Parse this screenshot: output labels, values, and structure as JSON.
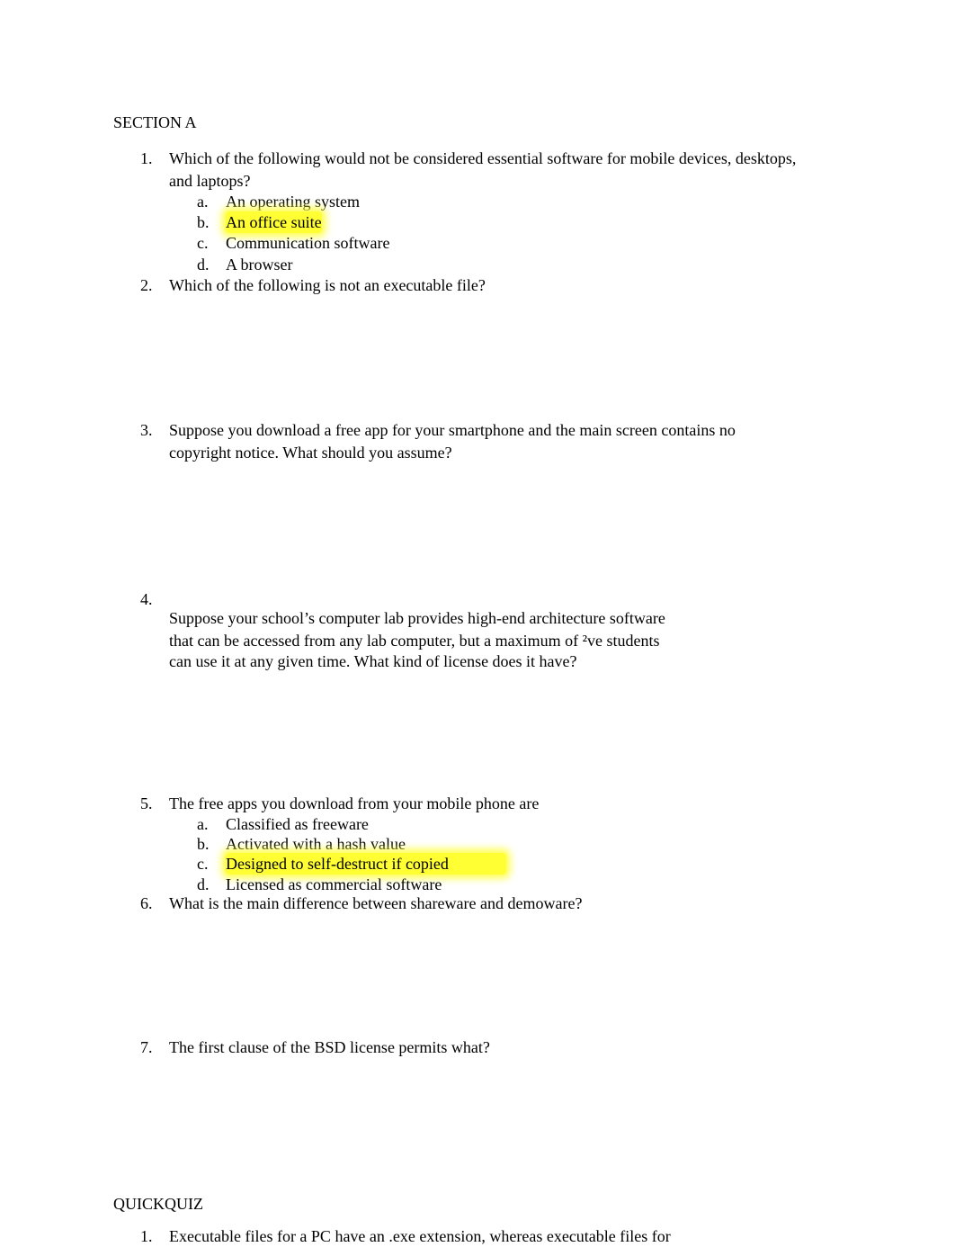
{
  "sections": {
    "section_a_title": "SECTION A",
    "quickquiz_title": "QUICKQUIZ"
  },
  "questions": [
    {
      "number": "1.",
      "line1": "Which of the following would not be considered essential software for mobile devices, desktops,",
      "line2": "and laptops?",
      "options": [
        {
          "letter": "a.",
          "text": "An operating system",
          "highlighted": false
        },
        {
          "letter": "b.",
          "text": "An office suite",
          "highlighted": true
        },
        {
          "letter": "c.",
          "text": "Communication software",
          "highlighted": false
        },
        {
          "letter": "d.",
          "text": "A browser",
          "highlighted": false
        }
      ]
    },
    {
      "number": "2.",
      "line1": "Which of the following is not an executable file?"
    },
    {
      "number": "3.",
      "line1": "Suppose you download a free app for your smartphone and the main screen contains no",
      "line2": "copyright notice. What should you assume?"
    },
    {
      "number": "4.",
      "line1": "Suppose your school’s computer lab provides high-end architecture software",
      "line2": "that can be accessed from any lab computer, but a maximum of ²ve students",
      "line3": "can use it at any given time. What kind of license does it have?"
    },
    {
      "number": "5.",
      "line1": "The free apps you download from your mobile phone are",
      "options": [
        {
          "letter": "a.",
          "text": "Classified as freeware",
          "highlighted": false
        },
        {
          "letter": "b.",
          "text": "Activated with a hash value",
          "highlighted": false
        },
        {
          "letter": "c.",
          "text": "Designed to self-destruct if copied",
          "highlighted": true
        },
        {
          "letter": "d.",
          "text": "Licensed as commercial software",
          "highlighted": false
        }
      ]
    },
    {
      "number": "6.",
      "line1": "What is the main difference between shareware and demoware?"
    },
    {
      "number": "7.",
      "line1": "The first clause of the BSD license permits what?"
    }
  ],
  "quickquiz": [
    {
      "number": "1.",
      "line1": "Executable files for a PC have an .exe extension, whereas executable files for"
    }
  ],
  "colors": {
    "highlight": "#ffff33"
  }
}
